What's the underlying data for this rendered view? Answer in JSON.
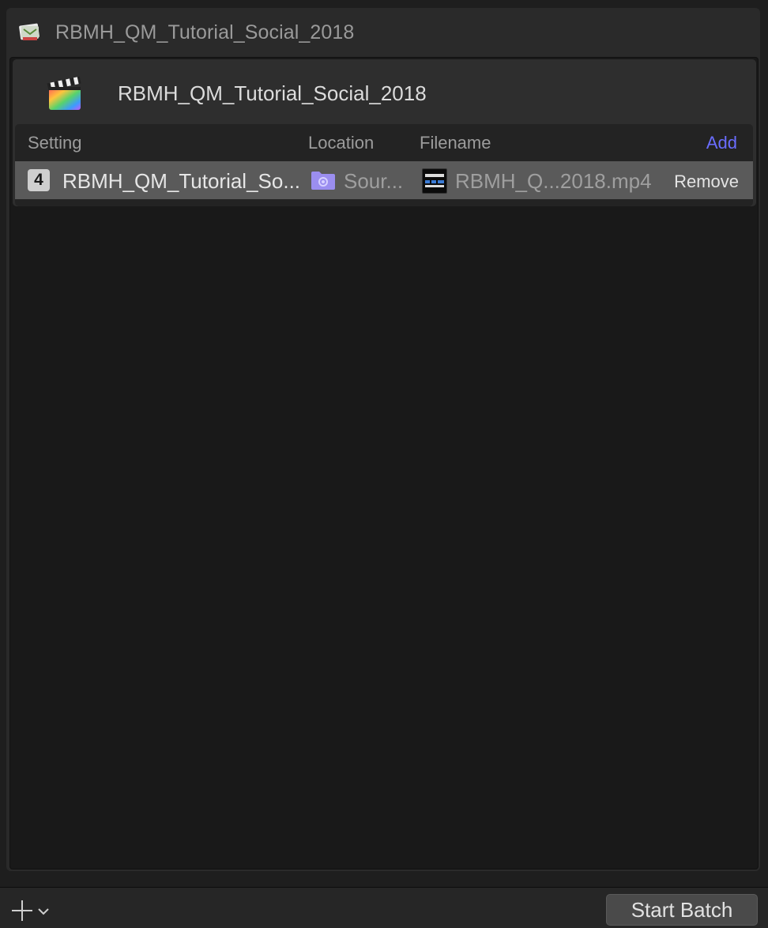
{
  "batch": {
    "title": "RBMH_QM_Tutorial_Social_2018"
  },
  "job": {
    "title": "RBMH_QM_Tutorial_Social_2018"
  },
  "table": {
    "columns": {
      "setting": "Setting",
      "location": "Location",
      "filename": "Filename"
    },
    "add_label": "Add"
  },
  "output": {
    "badge": "4",
    "setting": "RBMH_QM_Tutorial_So...",
    "location": "Sour...",
    "filename": "RBMH_Q...2018.mp4",
    "remove_label": "Remove"
  },
  "footer": {
    "start_label": "Start Batch"
  },
  "colors": {
    "accent_link": "#6a6dff",
    "row_highlight": "#5a5a5a",
    "folder": "#9b8ef0"
  }
}
